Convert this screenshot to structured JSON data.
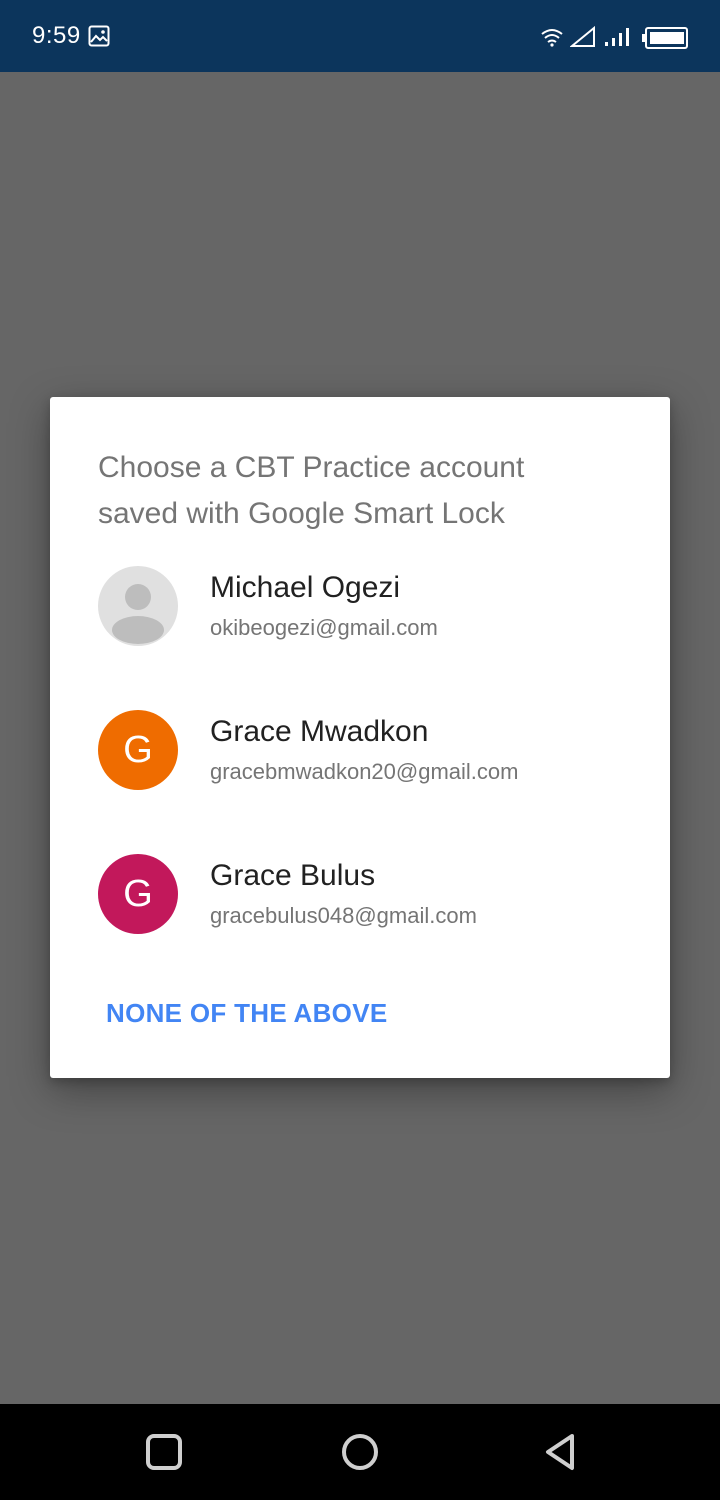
{
  "status_bar": {
    "time": "9:59",
    "icons": [
      "image-notification-icon",
      "wifi-icon",
      "signal-empty-icon",
      "signal-bars-icon",
      "battery-icon"
    ],
    "background_color": "#0c355c"
  },
  "dialog": {
    "title": "Choose a CBT Practice account saved with Google Smart Lock",
    "accounts": [
      {
        "name": "Michael Ogezi",
        "email": "okibeogezi@gmail.com",
        "avatar": "default-person",
        "avatar_letter": "",
        "avatar_color": "#e0e0e0"
      },
      {
        "name": "Grace Mwadkon",
        "email": "gracebmwadkon20@gmail.com",
        "avatar": "letter",
        "avatar_letter": "G",
        "avatar_color": "#ef6c00"
      },
      {
        "name": "Grace Bulus",
        "email": "gracebulus048@gmail.com",
        "avatar": "letter",
        "avatar_letter": "G",
        "avatar_color": "#c2185b"
      }
    ],
    "none_button_label": "NONE OF THE ABOVE",
    "accent_color": "#4285f4"
  },
  "nav_bar": {
    "buttons": [
      "recents-square-icon",
      "home-circle-icon",
      "back-triangle-icon"
    ]
  }
}
